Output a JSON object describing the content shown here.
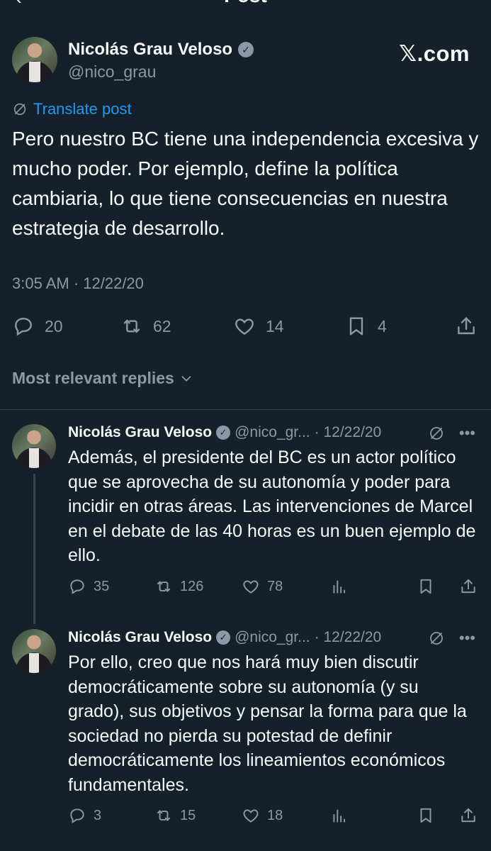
{
  "nav": {
    "title": "Post",
    "back_icon": "back-arrow-icon"
  },
  "main_post": {
    "author_name": "Nicolás Grau Veloso",
    "handle": "@nico_grau",
    "watermark": "𝕏.com",
    "translate_label": "Translate post",
    "text": "Pero nuestro BC tiene una independencia excesiva y mucho poder. Por ejemplo, define la política cambiaria, lo que tiene consecuencias en nuestra estrategia de desarrollo.",
    "time": "3:05 AM · 12/22/20",
    "replies": "20",
    "reposts": "62",
    "likes": "14",
    "bookmarks": "4"
  },
  "sort_label": "Most relevant replies",
  "replies": [
    {
      "author_name": "Nicolás Grau Veloso",
      "handle": "@nico_gr...",
      "date": "· 12/22/20",
      "text": "Además, el presidente del BC es un actor político que se aprovecha de su autonomía y poder para incidir en otras áreas. Las intervenciones de Marcel en el debate de las 40 horas es un buen ejemplo de ello.",
      "replies": "35",
      "reposts": "126",
      "likes": "78"
    },
    {
      "author_name": "Nicolás Grau Veloso",
      "handle": "@nico_gr...",
      "date": "· 12/22/20",
      "text": "Por ello, creo que nos hará muy bien discutir democráticamente sobre su autonomía (y su grado), sus objetivos y pensar la forma para que la sociedad no pierda su potestad de definir democráticamente los lineamientos económicos fundamentales.",
      "replies": "3",
      "reposts": "15",
      "likes": "18"
    }
  ],
  "colors": {
    "background": "#15202b",
    "text": "#f7f9f9",
    "muted": "#8b98a5",
    "link": "#1d9bf0",
    "divider": "#38444d"
  }
}
